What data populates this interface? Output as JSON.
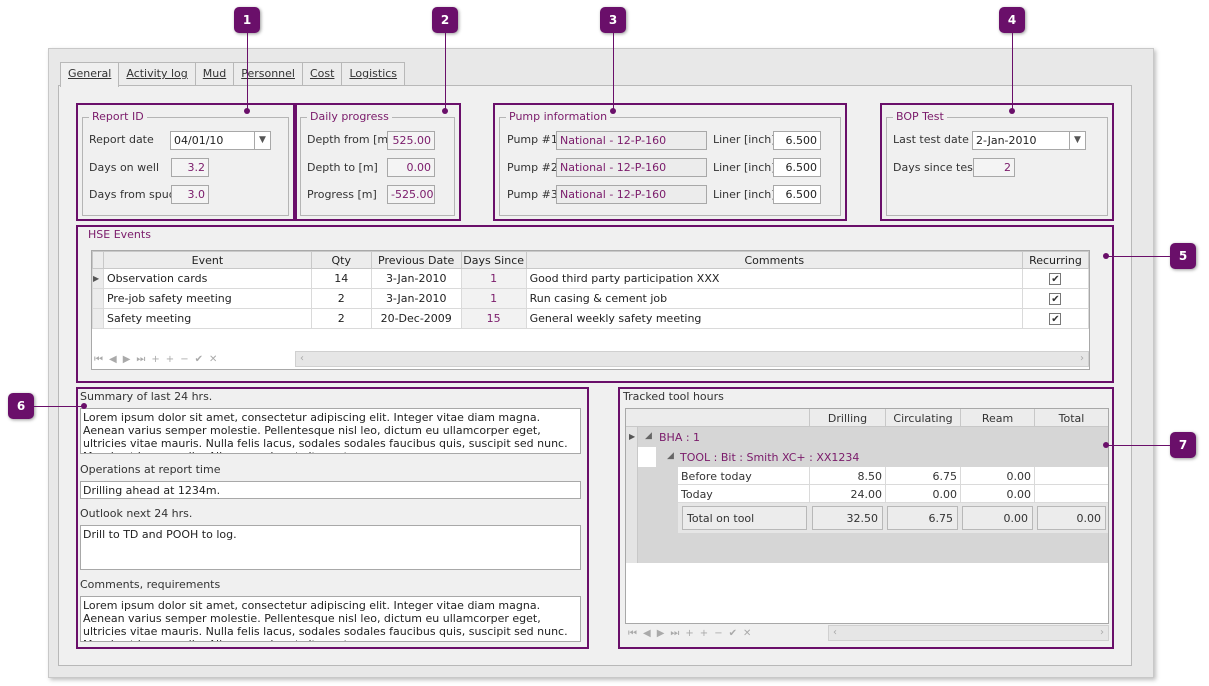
{
  "tabs": [
    "General",
    "Activity log",
    "Mud",
    "Personnel",
    "Cost",
    "Logistics"
  ],
  "callouts": [
    "1",
    "2",
    "3",
    "4",
    "5",
    "6",
    "7"
  ],
  "report_id": {
    "title": "Report ID",
    "report_date_label": "Report date",
    "report_date_value": "04/01/10",
    "days_on_well_label": "Days on well",
    "days_on_well_value": "3.2",
    "days_from_spud_label": "Days from spud",
    "days_from_spud_value": "3.0"
  },
  "daily_progress": {
    "title": "Daily progress",
    "depth_from_label": "Depth from [m]",
    "depth_from_value": "525.00",
    "depth_to_label": "Depth to [m]",
    "depth_to_value": "0.00",
    "progress_label": "Progress [m]",
    "progress_value": "-525.00"
  },
  "pump_info": {
    "title": "Pump information",
    "pumps": [
      {
        "label": "Pump #1",
        "value": "National - 12-P-160",
        "liner_label": "Liner [inch]",
        "liner": "6.500"
      },
      {
        "label": "Pump #2",
        "value": "National - 12-P-160",
        "liner_label": "Liner [inch]",
        "liner": "6.500"
      },
      {
        "label": "Pump #3",
        "value": "National - 12-P-160",
        "liner_label": "Liner [inch]",
        "liner": "6.500"
      }
    ]
  },
  "bop_test": {
    "title": "BOP Test",
    "last_test_label": "Last test date",
    "last_test_value": "2-Jan-2010",
    "days_since_label": "Days since test",
    "days_since_value": "2"
  },
  "hse": {
    "title": "HSE Events",
    "columns": [
      "Event",
      "Qty",
      "Previous Date",
      "Days Since",
      "Comments",
      "Recurring"
    ],
    "rows": [
      {
        "event": "Observation cards",
        "qty": "14",
        "prev": "3-Jan-2010",
        "days": "1",
        "comment": "Good third party participation  XXX",
        "recurring": "✔"
      },
      {
        "event": "Pre-job safety meeting",
        "qty": "2",
        "prev": "3-Jan-2010",
        "days": "1",
        "comment": "Run casing & cement job",
        "recurring": "✔"
      },
      {
        "event": "Safety meeting",
        "qty": "2",
        "prev": "20-Dec-2009",
        "days": "15",
        "comment": "General weekly safety meeting",
        "recurring": "✔"
      }
    ]
  },
  "summary": {
    "summary_label": "Summary of  last 24 hrs.",
    "summary_text": "Lorem ipsum dolor sit amet, consectetur adipiscing elit. Integer vitae diam magna. Aenean varius semper molestie. Pellentesque nisl leo, dictum eu ullamcorper eget, ultricies vitae mauris. Nulla felis lacus, sodales sodales faucibus quis, suscipit sed nunc. Mauris ut ipsum nulla. Aliquam vel erat sit amet",
    "ops_label": "Operations at report time",
    "ops_text": "Drilling ahead at 1234m.",
    "outlook_label": "Outlook next 24 hrs.",
    "outlook_text": "Drill to TD and POOH to log.",
    "comments_label": "Comments, requirements",
    "comments_text": "Lorem ipsum dolor sit amet, consectetur adipiscing elit. Integer vitae diam magna. Aenean varius semper molestie. Pellentesque nisl leo, dictum eu ullamcorper eget, ultricies vitae mauris. Nulla felis lacus, sodales sodales faucibus quis, suscipit sed nunc. Mauris ut ipsum nulla. Aliquam vel erat sit amet"
  },
  "tool_hours": {
    "title": "Tracked tool hours",
    "columns": [
      "Drilling",
      "Circulating",
      "Ream",
      "Total"
    ],
    "bha_label": "BHA : 1",
    "tool_label": "TOOL : Bit : Smith XC+ : XX1234",
    "rows": [
      {
        "label": "Before today",
        "drilling": "8.50",
        "circulating": "6.75",
        "ream": "0.00",
        "total": ""
      },
      {
        "label": "Today",
        "drilling": "24.00",
        "circulating": "0.00",
        "ream": "0.00",
        "total": ""
      }
    ],
    "total_label": "Total on tool",
    "total_drilling": "32.50",
    "total_circulating": "6.75",
    "total_ream": "0.00",
    "total_total": "0.00"
  },
  "nav_icons": [
    "first-icon",
    "prev-icon",
    "next-icon",
    "last-icon",
    "add-icon",
    "insert-icon",
    "delete-icon",
    "confirm-icon",
    "cancel-icon"
  ]
}
